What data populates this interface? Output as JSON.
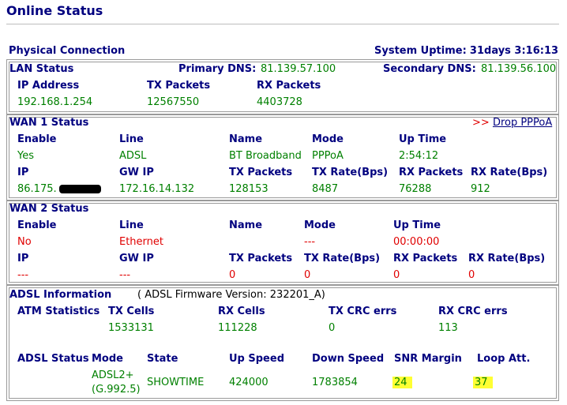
{
  "page_title": "Online Status",
  "physical": {
    "section_label": "Physical Connection",
    "uptime_label": "System Uptime:",
    "uptime_value": "31days 3:16:13"
  },
  "lan": {
    "title": "LAN Status",
    "primary_dns_label": "Primary DNS:",
    "primary_dns_value": "81.139.57.100",
    "secondary_dns_label": "Secondary DNS:",
    "secondary_dns_value": "81.139.56.100",
    "headers": [
      "IP Address",
      "TX Packets",
      "RX Packets"
    ],
    "values": [
      "192.168.1.254",
      "12567550",
      "4403728"
    ]
  },
  "wan1": {
    "title": "WAN 1 Status",
    "action_prefix": ">>",
    "action_label": "Drop PPPoA",
    "headers1": [
      "Enable",
      "Line",
      "Name",
      "Mode",
      "Up Time"
    ],
    "values1": [
      "Yes",
      "ADSL",
      "BT Broadband",
      "PPPoA",
      "2:54:12"
    ],
    "headers2": [
      "IP",
      "GW IP",
      "TX Packets",
      "TX Rate(Bps)",
      "RX Packets",
      "RX Rate(Bps)"
    ],
    "values2": [
      "86.175.",
      "172.16.14.132",
      "128153",
      "8487",
      "76288",
      "912"
    ]
  },
  "wan2": {
    "title": "WAN 2 Status",
    "headers1": [
      "Enable",
      "Line",
      "Name",
      "Mode",
      "Up Time"
    ],
    "values1": [
      "No",
      "Ethernet",
      "",
      "---",
      "00:00:00"
    ],
    "headers2": [
      "IP",
      "GW IP",
      "TX Packets",
      "TX Rate(Bps)",
      "RX Packets",
      "RX Rate(Bps)"
    ],
    "values2": [
      "---",
      "---",
      "0",
      "0",
      "0",
      "0"
    ]
  },
  "adsl": {
    "title": "ADSL Information",
    "firmware_open": "( ADSL Firmware Version:",
    "firmware_value": "232201_A)",
    "atm_label": "ATM Statistics",
    "atm_headers": [
      "TX Cells",
      "RX Cells",
      "TX CRC errs",
      "RX CRC errs"
    ],
    "atm_values": [
      "1533131",
      "111228",
      "0",
      "113"
    ],
    "status_label": "ADSL Status",
    "status_headers": [
      "Mode",
      "State",
      "Up Speed",
      "Down Speed",
      "SNR Margin",
      "Loop Att."
    ],
    "mode_line1": "ADSL2+",
    "mode_line2": "(G.992.5)",
    "status_values": [
      "SHOWTIME",
      "424000",
      "1783854",
      "24",
      "37"
    ]
  }
}
